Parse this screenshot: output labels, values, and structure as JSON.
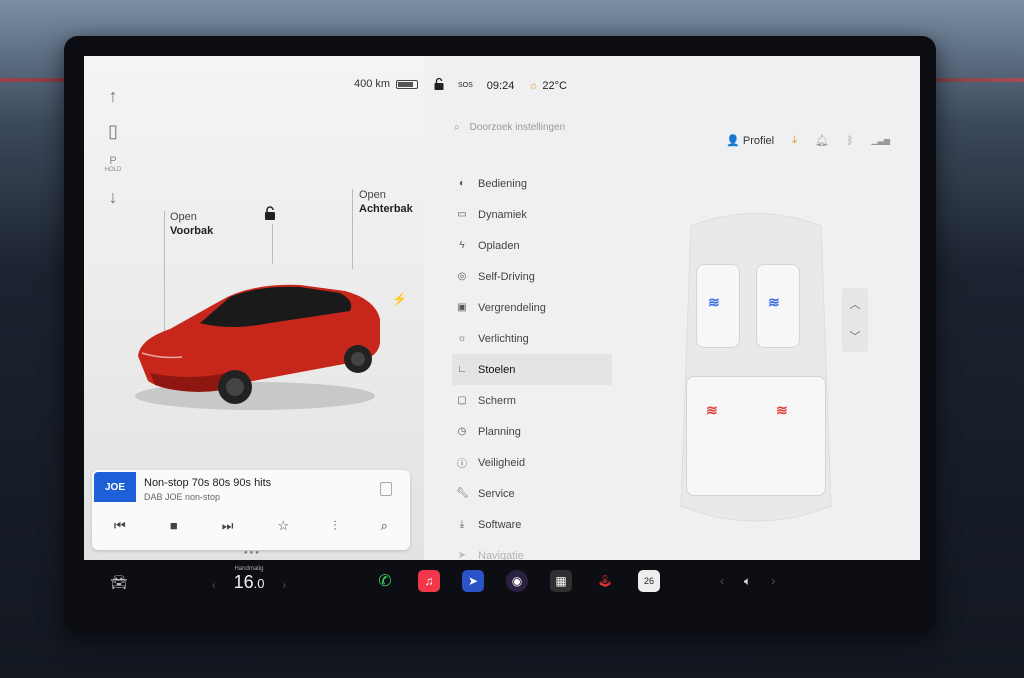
{
  "left": {
    "range": "400 km",
    "gear_p": "P",
    "gear_hold": "HOLD",
    "frunk_open": "Open",
    "frunk_name": "Voorbak",
    "trunk_open": "Open",
    "trunk_name": "Achterbak",
    "battery_level": 0.85
  },
  "status": {
    "sos": "SOS",
    "time": "09:24",
    "temperature": "22°C"
  },
  "search": {
    "placeholder": "Doorzoek instellingen"
  },
  "header": {
    "profile": "Profiel"
  },
  "menu": [
    {
      "label": "Bediening",
      "icon": "toggle-icon"
    },
    {
      "label": "Dynamiek",
      "icon": "car-icon"
    },
    {
      "label": "Opladen",
      "icon": "bolt-icon"
    },
    {
      "label": "Self-Driving",
      "icon": "steering-wheel-icon"
    },
    {
      "label": "Vergrendeling",
      "icon": "lock-icon"
    },
    {
      "label": "Verlichting",
      "icon": "light-icon"
    },
    {
      "label": "Stoelen",
      "icon": "seat-icon",
      "active": true
    },
    {
      "label": "Scherm",
      "icon": "display-icon"
    },
    {
      "label": "Planning",
      "icon": "clock-icon"
    },
    {
      "label": "Veiligheid",
      "icon": "info-icon"
    },
    {
      "label": "Service",
      "icon": "wrench-icon"
    },
    {
      "label": "Software",
      "icon": "download-icon"
    },
    {
      "label": "Navigatie",
      "icon": "nav-icon"
    }
  ],
  "media": {
    "logo": "JOE",
    "title": "Non-stop 70s 80s 90s hits",
    "subtitle": "DAB JOE non-stop"
  },
  "climate": {
    "mode": "Handmatig",
    "temp_int": "16",
    "temp_dec": ".0"
  },
  "calendar_day": "26",
  "colors": {
    "accent_heat_front": "#3d6fe6",
    "accent_heat_rear": "#e0453b",
    "download": "#e89020"
  }
}
